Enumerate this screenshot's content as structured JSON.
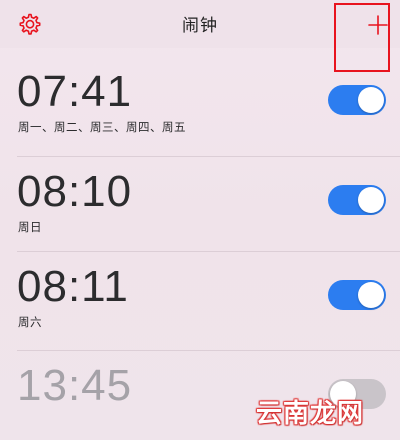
{
  "nav": {
    "title": "闹钟",
    "settings_icon": "gear-icon",
    "add_icon": "plus-icon"
  },
  "colors": {
    "accent": "#e8131e",
    "toggle_on": "#2c7df0",
    "toggle_off": "#c9c4c9"
  },
  "alarms": [
    {
      "time": "07:41",
      "days": "周一、周二、周三、周四、周五",
      "enabled": true
    },
    {
      "time": "08:10",
      "days": "周日",
      "enabled": true
    },
    {
      "time": "08:11",
      "days": "周六",
      "enabled": true
    },
    {
      "time": "13:45",
      "days": "",
      "enabled": false
    }
  ],
  "watermark": "云南龙网"
}
